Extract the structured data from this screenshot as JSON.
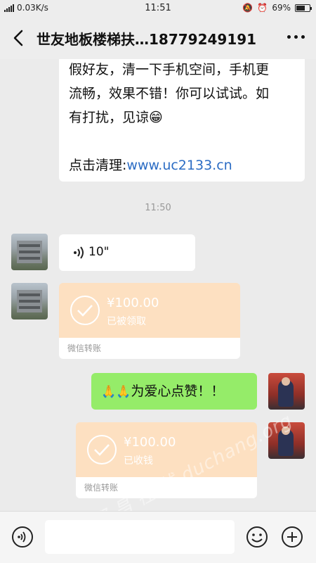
{
  "status_bar": {
    "network_speed": "0.03K/s",
    "time": "11:51",
    "battery": "69%",
    "battery_level": 0.69
  },
  "nav": {
    "title": "世友地板楼梯扶…18779249191"
  },
  "messages": {
    "first_text_lines": [
      "假好友，清一下手机空间，手机更",
      "流畅，效果不错！你可以试试。如",
      "有打扰，见谅"
    ],
    "first_emoji": "😁",
    "clean_prefix": "点击清理:",
    "clean_link": "www.uc2133.cn",
    "timestamp": "11:50",
    "voice_duration": "10\"",
    "transfer1": {
      "amount": "¥100.00",
      "status": "已被领取",
      "label": "微信转账"
    },
    "green_text": "为爱心点赞！！",
    "green_emoji": "🙏🙏",
    "transfer2": {
      "amount": "¥100.00",
      "status": "已收钱",
      "label": "微信转账"
    }
  },
  "colors": {
    "green_bubble": "#95ec69",
    "transfer_bg": "#fde0c1",
    "link": "#2b6cc4"
  },
  "watermark": "都 昌 在 线 duchang.org",
  "icons": [
    "back-arrow-icon",
    "more-dots-icon",
    "voice-wave-icon",
    "check-circle-icon",
    "voice-input-icon",
    "emoji-icon",
    "plus-icon"
  ]
}
